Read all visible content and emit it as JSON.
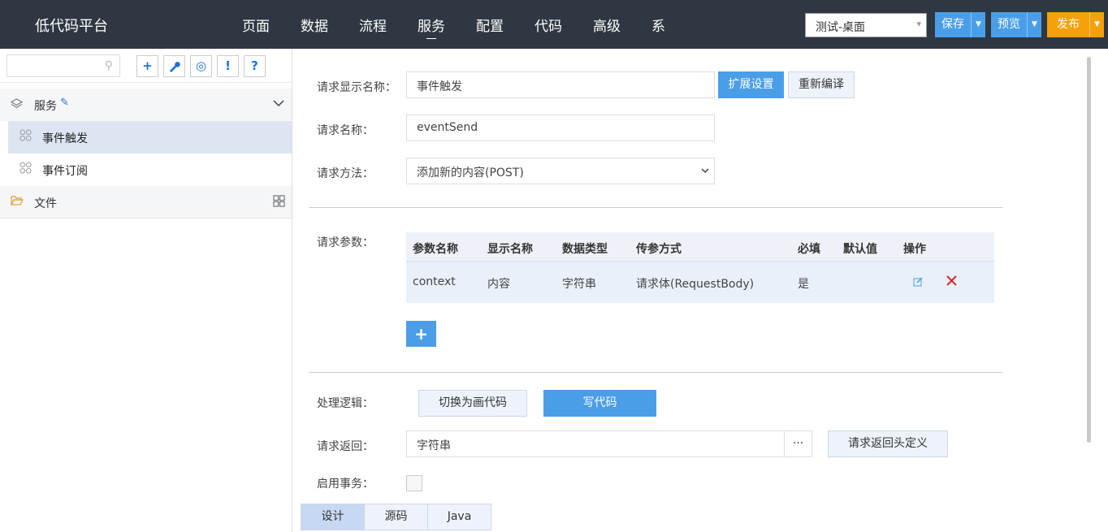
{
  "app": {
    "title": "低代码平台"
  },
  "nav": {
    "items": [
      "页面",
      "数据",
      "流程",
      "服务",
      "配置",
      "代码",
      "高级",
      "系"
    ],
    "active": "服务"
  },
  "env": {
    "selected": "测试-桌面"
  },
  "actions": {
    "save": "保存",
    "preview": "预览",
    "publish": "发布"
  },
  "sidebar": {
    "search_placeholder": "",
    "tools": {
      "add": "+",
      "wrench": "🔧",
      "target": "◎",
      "alert": "!",
      "help": "?"
    },
    "group_service": "服务",
    "items": [
      {
        "label": "事件触发",
        "selected": true
      },
      {
        "label": "事件订阅",
        "selected": false
      }
    ],
    "group_file": "文件"
  },
  "form": {
    "display_name_label": "请求显示名称：",
    "display_name_value": "事件触发",
    "ext_settings": "扩展设置",
    "recompile": "重新编译",
    "name_label": "请求名称：",
    "name_value": "eventSend",
    "method_label": "请求方法：",
    "method_value": "添加新的内容(POST)",
    "params_label": "请求参数：",
    "param_headers": [
      "参数名称",
      "显示名称",
      "数据类型",
      "传参方式",
      "必填",
      "默认值",
      "操作"
    ],
    "param_rows": [
      {
        "name": "context",
        "display": "内容",
        "type": "字符串",
        "mode": "请求体(RequestBody)",
        "required": "是",
        "default": ""
      }
    ],
    "add_param": "+",
    "logic_label": "处理逻辑：",
    "switch_draw": "切换为画代码",
    "write_code": "写代码",
    "return_label": "请求返回：",
    "return_value": "字符串",
    "return_more": "···",
    "return_header": "请求返回头定义",
    "transaction_label": "启用事务："
  },
  "tabs": [
    "设计",
    "源码",
    "Java"
  ],
  "colors": {
    "topbar": "#2f3742",
    "primary": "#4a9ee8",
    "publish": "#f5a10a",
    "delete": "#d9262c"
  }
}
